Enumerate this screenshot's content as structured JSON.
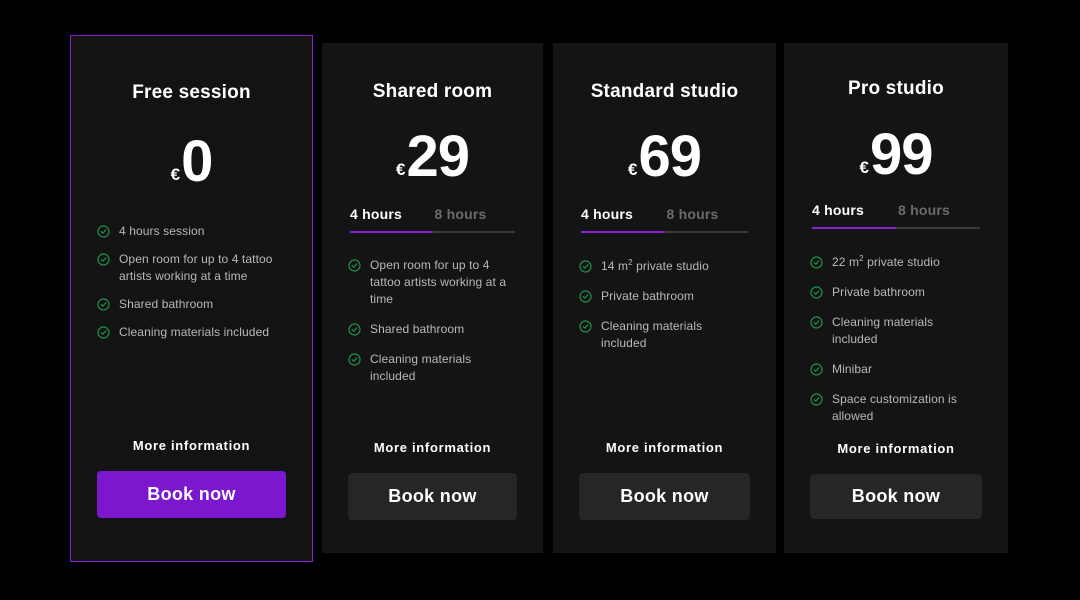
{
  "theme": {
    "page_background": "#000000",
    "card_background": "#141414",
    "accent": "#8B1FD4",
    "cta_primary": "#7B18CE",
    "cta_secondary": "#262626",
    "check_color": "#1f9c4d",
    "feature_text_color": "#b9b9b9",
    "tab_inactive_color": "#6b6b6b"
  },
  "labels": {
    "more_information": "More information",
    "book_now": "Book now",
    "currency_symbol": "€"
  },
  "plans": [
    {
      "id": "free-session",
      "name": "Free session",
      "currency": "€",
      "price": "0",
      "featured": true,
      "has_tabs": false,
      "tabs": [],
      "features": [
        "4 hours session",
        "Open room for up to 4 tattoo artists working at a time",
        "Shared bathroom",
        "Cleaning materials included"
      ],
      "more_information": "More information",
      "cta_label": "Book now",
      "cta_style": "primary"
    },
    {
      "id": "shared-room",
      "name": "Shared room",
      "currency": "€",
      "price": "29",
      "featured": false,
      "has_tabs": true,
      "tabs": [
        {
          "label": "4 hours",
          "active": true
        },
        {
          "label": "8 hours",
          "active": false
        }
      ],
      "features": [
        "Open room for up to 4 tattoo artists working at a time",
        "Shared bathroom",
        "Cleaning materials included"
      ],
      "more_information": "More information",
      "cta_label": "Book now",
      "cta_style": "secondary"
    },
    {
      "id": "standard-studio",
      "name": "Standard studio",
      "currency": "€",
      "price": "69",
      "featured": false,
      "has_tabs": true,
      "tabs": [
        {
          "label": "4 hours",
          "active": true
        },
        {
          "label": "8 hours",
          "active": false
        }
      ],
      "features": [
        "14 m² private studio",
        "Private bathroom",
        "Cleaning materials included"
      ],
      "more_information": "More information",
      "cta_label": "Book now",
      "cta_style": "secondary"
    },
    {
      "id": "pro-studio",
      "name": "Pro studio",
      "currency": "€",
      "price": "99",
      "featured": false,
      "has_tabs": true,
      "tabs": [
        {
          "label": "4 hours",
          "active": true
        },
        {
          "label": "8 hours",
          "active": false
        }
      ],
      "features": [
        "22 m² private studio",
        "Private bathroom",
        "Cleaning materials included",
        "Minibar",
        "Space customization is allowed"
      ],
      "more_information": "More information",
      "cta_label": "Book now",
      "cta_style": "secondary"
    }
  ]
}
